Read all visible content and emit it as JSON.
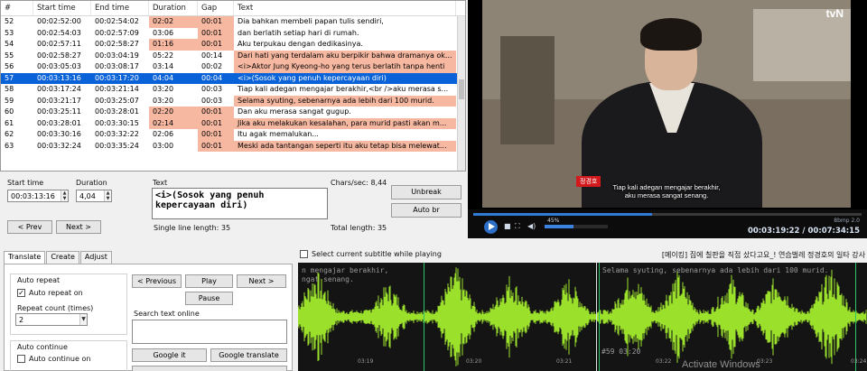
{
  "grid": {
    "headers": [
      "#",
      "Start time",
      "End time",
      "Duration",
      "Gap",
      "Text"
    ],
    "rows": [
      {
        "num": "52",
        "start": "00:02:52:00",
        "end": "00:02:54:02",
        "dur": "02:02",
        "gap": "00:01",
        "text": "Dia bahkan membeli papan tulis sendiri,",
        "dur_bad": true,
        "gap_bad": true,
        "alt": false
      },
      {
        "num": "53",
        "start": "00:02:54:03",
        "end": "00:02:57:09",
        "dur": "03:06",
        "gap": "00:01",
        "text": "dan berlatih setiap hari di rumah.",
        "dur_bad": false,
        "gap_bad": true,
        "alt": false
      },
      {
        "num": "54",
        "start": "00:02:57:11",
        "end": "00:02:58:27",
        "dur": "01:16",
        "gap": "00:01",
        "text": "Aku terpukau dengan dedikasinya.",
        "dur_bad": true,
        "gap_bad": true,
        "alt": false
      },
      {
        "num": "55",
        "start": "00:02:58:27",
        "end": "00:03:04:19",
        "dur": "05:22",
        "gap": "00:14",
        "text": "Dari hati yang terdalam aku berpikir bahwa dramanya ok...",
        "dur_bad": false,
        "gap_bad": false,
        "alt": true
      },
      {
        "num": "56",
        "start": "00:03:05:03",
        "end": "00:03:08:17",
        "dur": "03:14",
        "gap": "00:02",
        "text": "<i>Aktor Jung Kyeong-ho yang terus berlatih tanpa henti",
        "dur_bad": false,
        "gap_bad": false,
        "alt": true
      },
      {
        "num": "57",
        "start": "00:03:13:16",
        "end": "00:03:17:20",
        "dur": "04:04",
        "gap": "00:04",
        "text": "<i>(Sosok yang penuh kepercayaan diri)",
        "dur_bad": false,
        "gap_bad": false,
        "alt": false,
        "selected": true
      },
      {
        "num": "58",
        "start": "00:03:17:24",
        "end": "00:03:21:14",
        "dur": "03:20",
        "gap": "00:03",
        "text": "Tiap kali adegan mengajar berakhir,<br />aku merasa s...",
        "dur_bad": false,
        "gap_bad": false,
        "alt": false
      },
      {
        "num": "59",
        "start": "00:03:21:17",
        "end": "00:03:25:07",
        "dur": "03:20",
        "gap": "00:03",
        "text": "Selama syuting, sebenarnya ada lebih dari 100 murid.",
        "dur_bad": false,
        "gap_bad": false,
        "alt": true
      },
      {
        "num": "60",
        "start": "00:03:25:11",
        "end": "00:03:28:01",
        "dur": "02:20",
        "gap": "00:01",
        "text": "Dan aku merasa sangat gugup.",
        "dur_bad": true,
        "gap_bad": true,
        "alt": false
      },
      {
        "num": "61",
        "start": "00:03:28:01",
        "end": "00:03:30:15",
        "dur": "02:14",
        "gap": "00:01",
        "text": "Jika aku melakukan kesalahan, para murid pasti akan m...",
        "dur_bad": true,
        "gap_bad": true,
        "alt": true
      },
      {
        "num": "62",
        "start": "00:03:30:16",
        "end": "00:03:32:22",
        "dur": "02:06",
        "gap": "00:01",
        "text": "Itu agak memalukan...",
        "dur_bad": false,
        "gap_bad": true,
        "alt": false
      },
      {
        "num": "63",
        "start": "00:03:32:24",
        "end": "00:03:35:24",
        "dur": "03:00",
        "gap": "00:01",
        "text": "Meski ada tantangan seperti itu aku tetap bisa melewat...",
        "dur_bad": false,
        "gap_bad": true,
        "alt": true
      }
    ]
  },
  "editor": {
    "start_label": "Start time",
    "duration_label": "Duration",
    "text_label": "Text",
    "chars_sec": "Chars/sec: 8,44",
    "start_value": "00:03:13:16",
    "duration_value": "4,04",
    "text_value": "<i>(Sosok yang penuh kepercayaan diri)",
    "single_line": "Single line length: 35",
    "total_length": "Total length: 35",
    "prev_btn": "< Prev",
    "next_btn": "Next >",
    "unbreak_btn": "Unbreak",
    "autobr_btn": "Auto br"
  },
  "video": {
    "channel_logo": "tvN",
    "caption_line1": "Tiap kali adegan mengajar berakhir,",
    "caption_line2": "aku merasa sangat senang.",
    "name_tag": "정경호",
    "progress_fraction": 0.46,
    "volume_label": "45%",
    "volume_fraction": 0.45,
    "codec": "8bmp 2.0",
    "time": "00:03:19:22 / 00:07:34:15"
  },
  "tabs": {
    "translate": "Translate",
    "create": "Create",
    "adjust": "Adjust"
  },
  "translate_panel": {
    "auto_repeat_group": "Auto repeat",
    "auto_repeat_on": "Auto repeat on",
    "repeat_count_label": "Repeat count (times)",
    "repeat_count_value": "2",
    "auto_continue_group": "Auto continue",
    "auto_continue_on": "Auto continue on",
    "previous_btn": "< Previous",
    "play_btn": "Play",
    "next_btn": "Next >",
    "pause_btn": "Pause",
    "search_label": "Search text online",
    "google_it_btn": "Google it",
    "google_translate_btn": "Google translate"
  },
  "waveform": {
    "select_current": "Select current subtitle while playing",
    "title": "[메이킹] 집에 칠판을 직접 샀다고요_! 연습벌레 정경호의 일타 강사",
    "region1_text": "n mengajar berakhir,",
    "region1_text2": "ngat senang.",
    "region2_text": "Selama syuting, sebenarnya ada lebih dari 100 murid.",
    "region2_label": "#59  03:20",
    "ticks": [
      "03:19",
      "03:20",
      "03:21",
      "03:22",
      "03:23",
      "03:24"
    ],
    "wave_color": "#9be12b"
  },
  "os": {
    "watermark": "Activate Windows"
  }
}
